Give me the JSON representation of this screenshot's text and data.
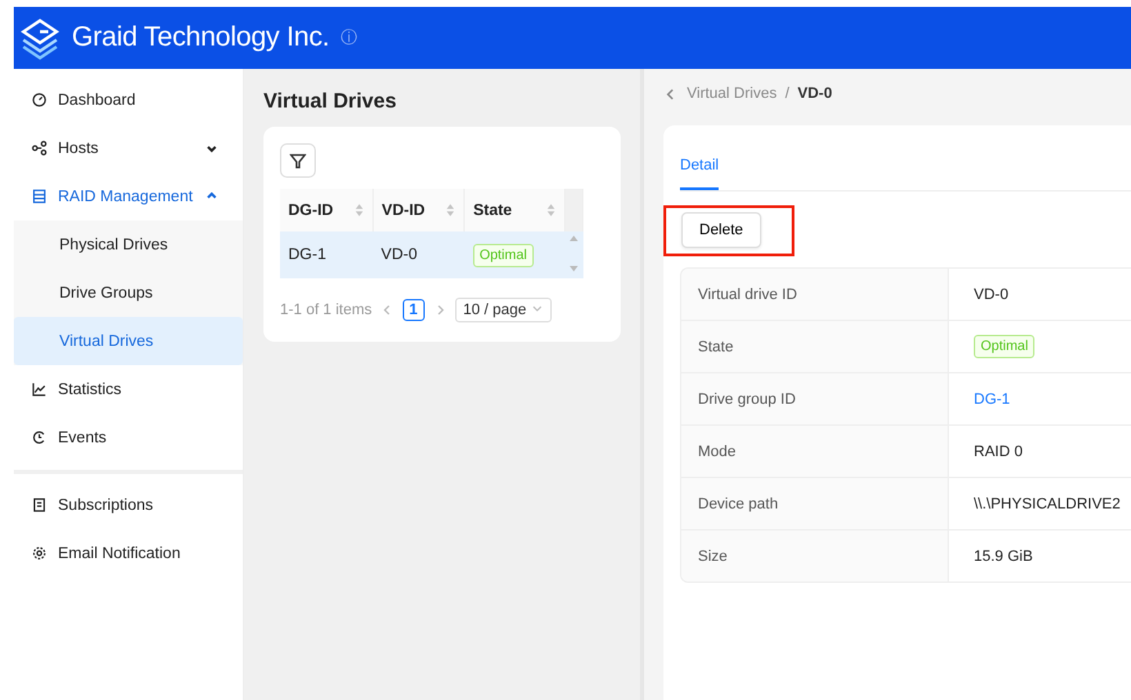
{
  "header": {
    "title": "Graid Technology Inc.",
    "info_icon": "ⓘ"
  },
  "sidebar": {
    "sections": [
      {
        "items": [
          {
            "label": "Dashboard",
            "selected": false
          },
          {
            "label": "Hosts",
            "selected": false,
            "expanded": false
          },
          {
            "label": "RAID Management",
            "selected": true,
            "expanded": true,
            "children": [
              {
                "label": "Physical Drives",
                "selected": false
              },
              {
                "label": "Drive Groups",
                "selected": false
              },
              {
                "label": "Virtual Drives",
                "selected": true
              }
            ]
          },
          {
            "label": "Statistics",
            "selected": false
          },
          {
            "label": "Events",
            "selected": false
          }
        ]
      },
      {
        "items": [
          {
            "label": "Subscriptions",
            "selected": false
          },
          {
            "label": "Email Notification",
            "selected": false
          }
        ]
      }
    ]
  },
  "list_panel": {
    "title": "Virtual Drives",
    "table": {
      "columns": [
        "DG-ID",
        "VD-ID",
        "State"
      ],
      "rows": [
        {
          "cells": [
            "DG-1",
            "VD-0",
            "Optimal"
          ],
          "selected": true
        }
      ]
    },
    "pagination": {
      "summary": "1-1 of 1 items",
      "pages": [
        {
          "label": "1",
          "selected": true
        }
      ],
      "page_size": "10 / page"
    }
  },
  "detail_panel": {
    "breadcrumb": [
      "Virtual Drives",
      "VD-0"
    ],
    "breadcrumb_separator": "/",
    "tabs": [
      {
        "label": "Detail",
        "selected": true
      }
    ],
    "delete_button": {
      "label": "Delete",
      "highlighted": true
    },
    "fields": [
      {
        "label": "Virtual drive ID",
        "value": "VD-0",
        "kind": "text"
      },
      {
        "label": "State",
        "value": "Optimal",
        "kind": "tag"
      },
      {
        "label": "Drive group ID",
        "value": "DG-1",
        "kind": "link"
      },
      {
        "label": "Mode",
        "value": "RAID 0",
        "kind": "text"
      },
      {
        "label": "Device path",
        "value": "\\\\.\\PHYSICALDRIVE2",
        "kind": "text"
      },
      {
        "label": "Size",
        "value": "15.9 GiB",
        "kind": "text"
      }
    ]
  }
}
